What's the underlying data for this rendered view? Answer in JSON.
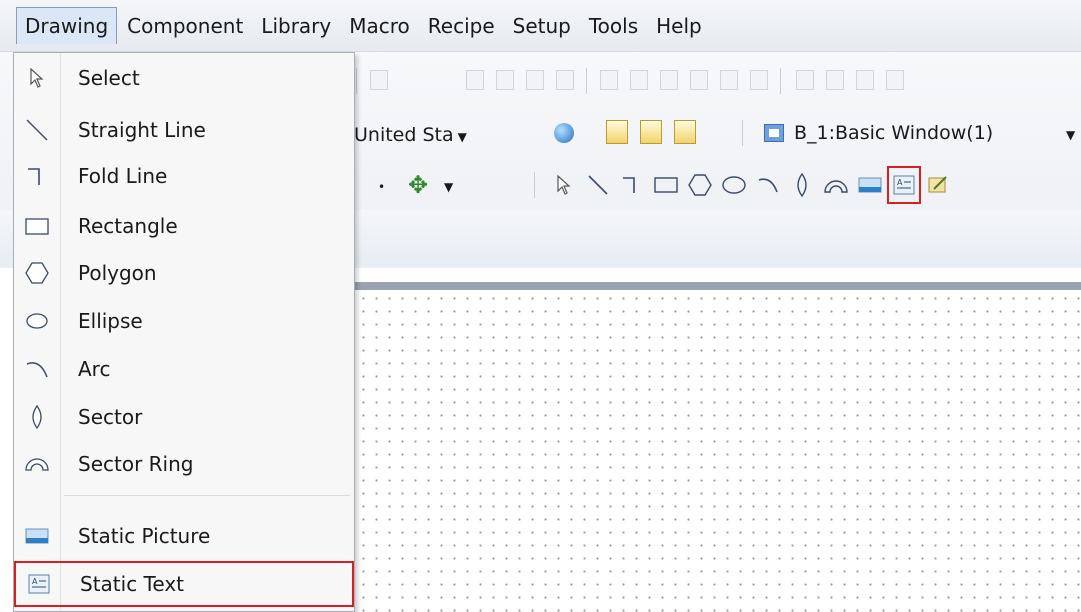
{
  "menubar": {
    "items": [
      {
        "label": "Drawing"
      },
      {
        "label": "Component"
      },
      {
        "label": "Library"
      },
      {
        "label": "Macro"
      },
      {
        "label": "Recipe"
      },
      {
        "label": "Setup"
      },
      {
        "label": "Tools"
      },
      {
        "label": "Help"
      }
    ],
    "active": "Drawing"
  },
  "toolbar": {
    "language_combo": "United Sta",
    "window_tab": "B_1:Basic Window(1)",
    "highlighted_tool": "static-text-icon"
  },
  "drawing_menu": {
    "items": [
      {
        "label": "Select",
        "icon": "select-arrow-icon"
      },
      {
        "label": "Straight Line",
        "icon": "straight-line-icon"
      },
      {
        "label": "Fold Line",
        "icon": "fold-line-icon"
      },
      {
        "label": "Rectangle",
        "icon": "rectangle-icon"
      },
      {
        "label": "Polygon",
        "icon": "polygon-icon"
      },
      {
        "label": "Ellipse",
        "icon": "ellipse-icon"
      },
      {
        "label": "Arc",
        "icon": "arc-icon"
      },
      {
        "label": "Sector",
        "icon": "sector-icon"
      },
      {
        "label": "Sector Ring",
        "icon": "sector-ring-icon"
      },
      {
        "label": "Static Picture",
        "icon": "static-picture-icon"
      },
      {
        "label": "Static Text",
        "icon": "static-text-icon"
      }
    ],
    "selected": "Static Text"
  },
  "colors": {
    "highlight_border": "#d92020",
    "menu_background": "#f7f7f7"
  }
}
